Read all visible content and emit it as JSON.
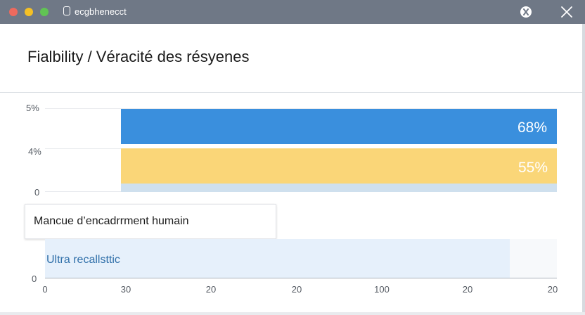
{
  "window": {
    "title": "ecgbhenecct"
  },
  "page": {
    "heading": "Fialbility / Véracité des résyenes"
  },
  "chart_data": {
    "type": "bar",
    "y_tick_labels": [
      "5%",
      "4%",
      "0"
    ],
    "bars": [
      {
        "label": "68%",
        "value": 68,
        "color": "#3a8fdd"
      },
      {
        "label": "55%",
        "value": 55,
        "color": "#fad678"
      }
    ],
    "category_label": "Mancue d’encadrrment humain",
    "lower_series_label": "Ultra recallsttic",
    "lower_y_label": "0",
    "x_tick_labels": [
      "0",
      "30",
      "20",
      "20",
      "100",
      "20",
      "20"
    ]
  },
  "colors": {
    "titlebar": "#6f7886",
    "accent_blue": "#3a8fdd",
    "accent_yellow": "#fad678",
    "lower_series": "#2f6fa9"
  },
  "icons": [
    "close-window-icon",
    "minimize-window-icon",
    "zoom-window-icon",
    "tab-icon",
    "settings-icon",
    "close-icon"
  ]
}
